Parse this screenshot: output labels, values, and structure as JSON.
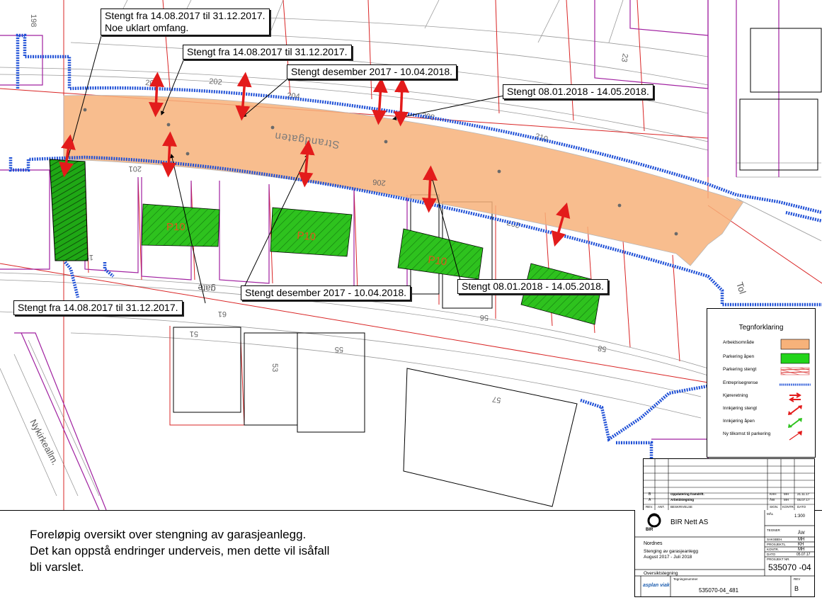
{
  "map": {
    "street_name": "Strandgaten",
    "parking_label": "P10",
    "street_labels": [
      "gate",
      "Nykirkeallm.",
      "Tol"
    ],
    "building_numbers": [
      "23",
      "51",
      "53",
      "55",
      "56",
      "57",
      "58",
      "61",
      "196",
      "198",
      "200",
      "201",
      "202",
      "204",
      "206",
      "207",
      "208",
      "210"
    ],
    "colors": {
      "work_area": "#f7b27a",
      "parking_open": "#2ec21e",
      "parking_closed": "#e05050",
      "boundary": "#1e4fd6",
      "arrow_closed": "#e31b1b",
      "property_line": "#d92525",
      "building_outline": "#a020a0",
      "contour": "#9a9a9a"
    }
  },
  "callouts": [
    {
      "lines": [
        "Stengt fra 14.08.2017 til 31.12.2017.",
        "Noe uklart omfang."
      ]
    },
    {
      "lines": [
        "Stengt fra 14.08.2017 til 31.12.2017."
      ]
    },
    {
      "lines": [
        "Stengt desember 2017 - 10.04.2018."
      ]
    },
    {
      "lines": [
        "Stengt 08.01.2018 - 14.05.2018."
      ]
    },
    {
      "lines": [
        "Stengt desember 2017 - 10.04.2018."
      ]
    },
    {
      "lines": [
        "Stengt 08.01.2018 - 14.05.2018."
      ]
    },
    {
      "lines": [
        "Stengt fra 14.08.2017 til 31.12.2017."
      ]
    }
  ],
  "legend": {
    "title": "Tegnforklaring",
    "items": [
      {
        "label": "Arbeidsområde",
        "icon": "work-area-swatch"
      },
      {
        "label": "Parkering åpen",
        "icon": "parking-open-swatch"
      },
      {
        "label": "Parkering stengt",
        "icon": "parking-closed-swatch"
      },
      {
        "label": "Entreprisegrense",
        "icon": "boundary-line"
      },
      {
        "label": "Kjøreretning",
        "icon": "driving-direction-arrows"
      },
      {
        "label": "Innkjøring stengt",
        "icon": "entry-closed-arrow"
      },
      {
        "label": "Innkjøring åpen",
        "icon": "entry-open-arrow"
      },
      {
        "label": "Ny tilkomst til parkering",
        "icon": "new-access-arrow"
      }
    ]
  },
  "note": {
    "lines": [
      "Foreløpig oversikt over stengning av garasjeanlegg.",
      "Det kan oppstå endringer underveis, men dette vil isåfall",
      "bli varslet."
    ]
  },
  "revisions": {
    "rows": [
      {
        "rev": "B",
        "desc": "Oppdatering framdrift.",
        "sign1": "KHH",
        "sign2": "MH",
        "date": "21.11.17"
      },
      {
        "rev": "A",
        "desc": "Arbeidstegning",
        "sign1": "ÅW",
        "sign2": "MH",
        "date": "05.07.17"
      }
    ],
    "headers": [
      "REV.",
      "ANT.",
      "BESKRIVELSE",
      "SIGN.",
      "KONTR.",
      "DATO"
    ]
  },
  "title_block": {
    "company": "BIR Nett AS",
    "logo_text": "BIR",
    "scale_label": "MÅL",
    "scale": "1:300",
    "project_lines": [
      "Nordnes",
      "Stenging av garasjeanlegg",
      "August 2017 - Juli 2018"
    ],
    "drawing_type": "Oversiktstegning",
    "roles": [
      {
        "label": "TEGNER",
        "value": "ÅW"
      },
      {
        "label": "SAKSBEH.",
        "value": "MH"
      },
      {
        "label": "PROSJEKTL.",
        "value": "KH"
      },
      {
        "label": "KONTR.",
        "value": "MH"
      },
      {
        "label": "DATO",
        "value": "05.07.17"
      }
    ],
    "project_no_label": "PROSJEKT NR.",
    "project_no": "535070 -04",
    "drawing_no_label": "Tegningsnummer",
    "drawing_no": "535070-04_481",
    "rev_label": "REV",
    "rev": "B",
    "consultant": "asplan viak"
  }
}
